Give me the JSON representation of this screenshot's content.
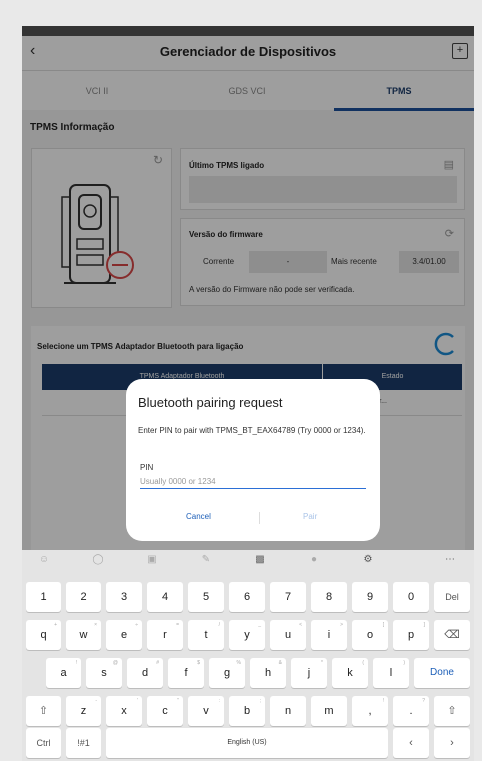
{
  "app": {
    "title": "Gerenciador de Dispositivos",
    "back_icon": "chevron-left-icon",
    "action_icon": "export-icon"
  },
  "tabs": [
    {
      "label": "VCI II",
      "active": false
    },
    {
      "label": "GDS VCI",
      "active": false
    },
    {
      "label": "TPMS",
      "active": true
    }
  ],
  "tpms": {
    "section_title": "TPMS Informação",
    "last_connected_label": "Último TPMS ligado",
    "last_connected_value": "",
    "firmware": {
      "label": "Versão do firmware",
      "current_label": "Corrente",
      "current_value": "-",
      "latest_label": "Mais recente",
      "latest_value": "3.4/01.00",
      "note": "A versão do Firmware não pode ser verificada."
    }
  },
  "bluetooth": {
    "section_title": "Selecione um TPMS Adaptador Bluetooth para ligação",
    "table": {
      "columns": [
        "TPMS Adaptador Bluetooth",
        "Estado"
      ],
      "rows": [
        {
          "name": "",
          "status": "A ligar..."
        }
      ]
    }
  },
  "dialog": {
    "title": "Bluetooth pairing request",
    "message": "Enter PIN to pair with TPMS_BT_EAX64789 (Try 0000 or 1234).",
    "pin_label": "PIN",
    "pin_placeholder": "Usually 0000 or 1234",
    "pin_value": "",
    "cancel": "Cancel",
    "pair": "Pair"
  },
  "keyboard": {
    "toolbar_icons": [
      "emoji-icon",
      "sticker-icon",
      "gif-icon",
      "handwriting-icon",
      "clipboard-icon",
      "mic-icon",
      "settings-icon",
      "more-icon"
    ],
    "row1": [
      "1",
      "2",
      "3",
      "4",
      "5",
      "6",
      "7",
      "8",
      "9",
      "0",
      "Del"
    ],
    "row2": [
      "q",
      "w",
      "e",
      "r",
      "t",
      "y",
      "u",
      "i",
      "o",
      "p"
    ],
    "row2_hints": [
      "+",
      "×",
      "÷",
      "=",
      "/",
      "_",
      "<",
      ">",
      "[",
      "]"
    ],
    "row3": [
      "a",
      "s",
      "d",
      "f",
      "g",
      "h",
      "j",
      "k",
      "l"
    ],
    "row3_hints": [
      "!",
      "@",
      "#",
      "$",
      "%",
      "&",
      "*",
      "(",
      ")"
    ],
    "row4": [
      "z",
      "x",
      "c",
      "v",
      "b",
      "n",
      "m",
      ",",
      "."
    ],
    "row4_hints": [
      "-",
      "'",
      "\"",
      ":",
      ";",
      "",
      "",
      "!",
      "?"
    ],
    "done": "Done",
    "ctrl": "Ctrl",
    "symbols": "!#1",
    "language": "English (US)"
  }
}
